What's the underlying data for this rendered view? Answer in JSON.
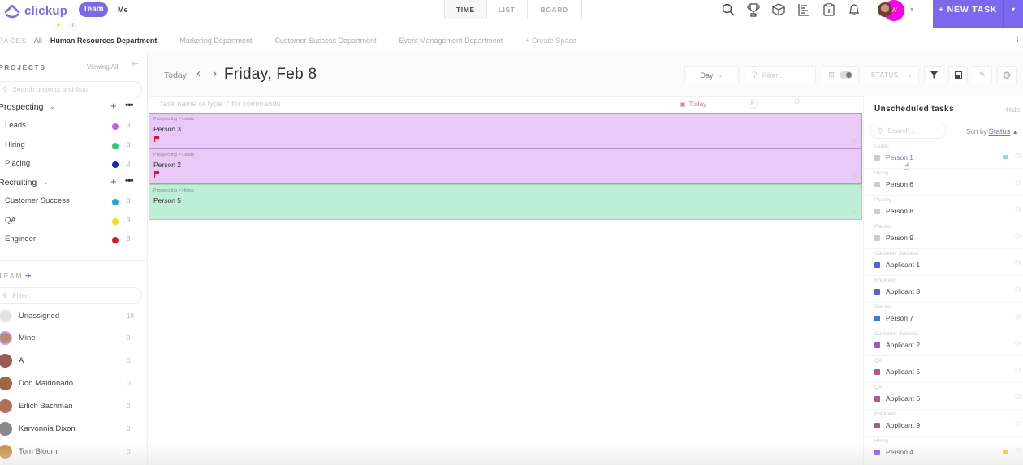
{
  "app": {
    "logo_text": "clickup",
    "team_label": "Team",
    "me_label": "Me",
    "mini_badges": [
      "★",
      "f"
    ]
  },
  "view_tabs": [
    {
      "label": "TIME",
      "active": true
    },
    {
      "label": "LIST",
      "active": false
    },
    {
      "label": "BOARD",
      "active": false
    }
  ],
  "top_icons": [
    "search-icon",
    "trophy-icon",
    "box-icon",
    "chart-icon",
    "clipboard-icon",
    "bell-icon"
  ],
  "user": {
    "initial": "W",
    "avatar_color": "#ff00e6"
  },
  "new_task": {
    "label": "+ NEW TASK",
    "caret": "▾"
  },
  "spaces": {
    "label": "SPACES",
    "all_label": "All",
    "items": [
      {
        "label": "Human Resources Department",
        "active": true
      },
      {
        "label": "Marketing Department",
        "active": false
      },
      {
        "label": "Customer Success Department",
        "active": false
      },
      {
        "label": "Event Management Department",
        "active": false
      }
    ],
    "create_label": "+ Create Space"
  },
  "sidebar": {
    "projects_title": "PROJECTS",
    "viewing_label": "Viewing All",
    "search_placeholder": "Search projects and lists",
    "groups": [
      {
        "name": "Prospecting",
        "items": [
          {
            "name": "Leads",
            "color": "#c25ee8",
            "count": "3"
          },
          {
            "name": "Hiring",
            "color": "#2ecd6f",
            "count": "3"
          },
          {
            "name": "Placing",
            "color": "#0a26d9",
            "count": "3"
          }
        ]
      },
      {
        "name": "Recruiting",
        "items": [
          {
            "name": "Customer Success",
            "color": "#1ba8dc",
            "count": "3"
          },
          {
            "name": "QA",
            "color": "#f2e01b",
            "count": "3"
          },
          {
            "name": "Engineer",
            "color": "#e0152b",
            "count": "3"
          }
        ]
      }
    ],
    "team_title": "TEAM",
    "team_filter_placeholder": "Filter...",
    "members": [
      {
        "name": "Unassigned",
        "count": "18",
        "avatar": "#d8d8d8"
      },
      {
        "name": "Mine",
        "count": "0",
        "avatar": "#c08a6a"
      },
      {
        "name": "A",
        "count": "0",
        "avatar": "#9a5a5a"
      },
      {
        "name": "Don Maldonado",
        "count": "0",
        "avatar": "#a0674a"
      },
      {
        "name": "Erlich Bachman",
        "count": "0",
        "avatar": "#b07055"
      },
      {
        "name": "Karvonnia Dixon",
        "count": "0",
        "avatar": "#888888"
      },
      {
        "name": "Tom Bloom",
        "count": "0",
        "avatar": "#c8893a"
      }
    ]
  },
  "main": {
    "today_label": "Today",
    "date_title": "Friday, Feb 8",
    "toolbar": {
      "day_select": "Day",
      "filter_placeholder": "Filter...",
      "status_select": "STATUS"
    },
    "new_task_placeholder": "Task name or type '/' for commands",
    "columns": {
      "due": "Today",
      "priority": "P"
    },
    "tasks": [
      {
        "crumb": "Prospecting > Leads",
        "name": "Person 3",
        "color": "purple",
        "flag": true
      },
      {
        "crumb": "Prospecting > Leads",
        "name": "Person 2",
        "color": "purple",
        "flag": true
      },
      {
        "crumb": "Prospecting > Hiring",
        "name": "Person 5",
        "color": "green",
        "flag": false
      }
    ]
  },
  "unscheduled": {
    "title": "Unscheduled tasks",
    "hide_label": "Hide",
    "search_placeholder": "Search...",
    "sort_label": "Sort by",
    "sort_value": "Status",
    "items": [
      {
        "group": "Leads",
        "name": "Person 1",
        "square": "#cccccc",
        "hover": true,
        "flag": "#8fd9e8"
      },
      {
        "group": "Hiring",
        "name": "Person 6",
        "square": "#cccccc"
      },
      {
        "group": "Placing",
        "name": "Person 8",
        "square": "#cccccc"
      },
      {
        "group": "Placing",
        "name": "Person 9",
        "square": "#cccccc"
      },
      {
        "group": "Customer Success",
        "name": "Applicant 1",
        "square": "#5b5bd6"
      },
      {
        "group": "Engineer",
        "name": "Applicant 8",
        "square": "#5b5bd6"
      },
      {
        "group": "Placing",
        "name": "Person 7",
        "square": "#3b7be0"
      },
      {
        "group": "Customer Success",
        "name": "Applicant 2",
        "square": "#a05ab8"
      },
      {
        "group": "QA",
        "name": "Applicant 5",
        "square": "#a85a8a"
      },
      {
        "group": "QA",
        "name": "Applicant 6",
        "square": "#a85a8a"
      },
      {
        "group": "Engineer",
        "name": "Applicant 9",
        "square": "#a85a8a"
      },
      {
        "group": "Hiring",
        "name": "Person 4",
        "square": "#7b4de0",
        "flag": "#f2d21b"
      }
    ]
  }
}
